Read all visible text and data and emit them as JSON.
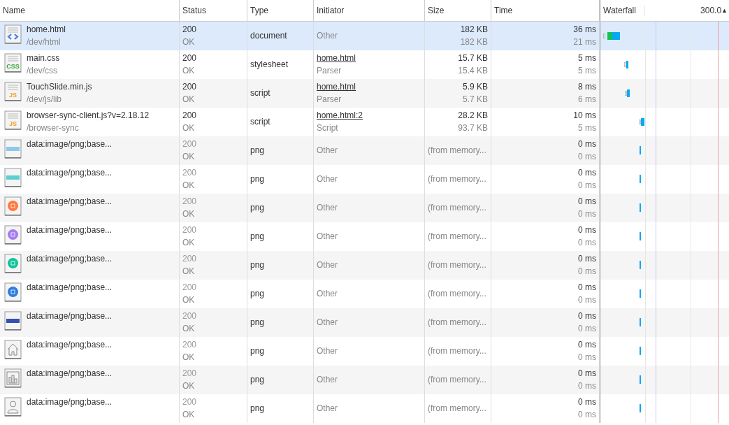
{
  "columns": [
    {
      "label": "Name"
    },
    {
      "label": "Status"
    },
    {
      "label": "Type"
    },
    {
      "label": "Initiator"
    },
    {
      "label": "Size"
    },
    {
      "label": "Time"
    },
    {
      "label": "Waterfall"
    }
  ],
  "waterfall_scale": "300.0",
  "sort_indicator": "▲",
  "rows": [
    {
      "icon": {
        "kind": "html"
      },
      "name": "home.html",
      "path": "/dev/html",
      "status": "200",
      "status_text": "OK",
      "type": "document",
      "initiator": "Other",
      "initiator_link": false,
      "size": "182 KB",
      "size_detail": "182 KB",
      "time": "36 ms",
      "latency": "21 ms",
      "selected": true,
      "from_cache": false
    },
    {
      "icon": {
        "kind": "doc",
        "label": "CSS",
        "color": "#3aa53a"
      },
      "name": "main.css",
      "path": "/dev/css",
      "status": "200",
      "status_text": "OK",
      "type": "stylesheet",
      "initiator": "home.html",
      "initiator_detail": "Parser",
      "initiator_link": true,
      "size": "15.7 KB",
      "size_detail": "15.4 KB",
      "time": "5 ms",
      "latency": "5 ms",
      "selected": false,
      "from_cache": false
    },
    {
      "icon": {
        "kind": "doc",
        "label": "JS",
        "color": "#f0a020"
      },
      "name": "TouchSlide.min.js",
      "path": "/dev/js/lib",
      "status": "200",
      "status_text": "OK",
      "type": "script",
      "initiator": "home.html",
      "initiator_detail": "Parser",
      "initiator_link": true,
      "size": "5.9 KB",
      "size_detail": "5.7 KB",
      "time": "8 ms",
      "latency": "6 ms",
      "selected": false,
      "from_cache": false
    },
    {
      "icon": {
        "kind": "doc",
        "label": "JS",
        "color": "#f0a020"
      },
      "name": "browser-sync-client.js?v=2.18.12",
      "path": "/browser-sync",
      "status": "200",
      "status_text": "OK",
      "type": "script",
      "initiator": "home.html:2",
      "initiator_detail": "Script",
      "initiator_link": true,
      "size": "28.2 KB",
      "size_detail": "93.7 KB",
      "time": "10 ms",
      "latency": "5 ms",
      "selected": false,
      "from_cache": false
    },
    {
      "icon": {
        "kind": "banner",
        "color": "#8fc8e8"
      },
      "name": "data:image/png;base...",
      "status": "200",
      "status_text": "OK",
      "type": "png",
      "initiator": "Other",
      "initiator_link": false,
      "size": "(from memory...",
      "time": "0 ms",
      "latency": "0 ms",
      "selected": false,
      "from_cache": true
    },
    {
      "icon": {
        "kind": "banner",
        "color": "#5ccfd0"
      },
      "name": "data:image/png;base...",
      "status": "200",
      "status_text": "OK",
      "type": "png",
      "initiator": "Other",
      "initiator_link": false,
      "size": "(from memory...",
      "time": "0 ms",
      "latency": "0 ms",
      "selected": false,
      "from_cache": true
    },
    {
      "icon": {
        "kind": "circle",
        "color": "#ff7a3d"
      },
      "name": "data:image/png;base...",
      "status": "200",
      "status_text": "OK",
      "type": "png",
      "initiator": "Other",
      "initiator_link": false,
      "size": "(from memory...",
      "time": "0 ms",
      "latency": "0 ms",
      "selected": false,
      "from_cache": true
    },
    {
      "icon": {
        "kind": "circle",
        "color": "#a67cf0"
      },
      "name": "data:image/png;base...",
      "status": "200",
      "status_text": "OK",
      "type": "png",
      "initiator": "Other",
      "initiator_link": false,
      "size": "(from memory...",
      "time": "0 ms",
      "latency": "0 ms",
      "selected": false,
      "from_cache": true
    },
    {
      "icon": {
        "kind": "circle",
        "color": "#14c29a"
      },
      "name": "data:image/png;base...",
      "status": "200",
      "status_text": "OK",
      "type": "png",
      "initiator": "Other",
      "initiator_link": false,
      "size": "(from memory...",
      "time": "0 ms",
      "latency": "0 ms",
      "selected": false,
      "from_cache": true
    },
    {
      "icon": {
        "kind": "circle",
        "color": "#2f7de0"
      },
      "name": "data:image/png;base...",
      "status": "200",
      "status_text": "OK",
      "type": "png",
      "initiator": "Other",
      "initiator_link": false,
      "size": "(from memory...",
      "time": "0 ms",
      "latency": "0 ms",
      "selected": false,
      "from_cache": true
    },
    {
      "icon": {
        "kind": "banner",
        "color": "#3450b0"
      },
      "name": "data:image/png;base...",
      "status": "200",
      "status_text": "OK",
      "type": "png",
      "initiator": "Other",
      "initiator_link": false,
      "size": "(from memory...",
      "time": "0 ms",
      "latency": "0 ms",
      "selected": false,
      "from_cache": true
    },
    {
      "icon": {
        "kind": "house"
      },
      "name": "data:image/png;base...",
      "status": "200",
      "status_text": "OK",
      "type": "png",
      "initiator": "Other",
      "initiator_link": false,
      "size": "(from memory...",
      "time": "0 ms",
      "latency": "0 ms",
      "selected": false,
      "from_cache": true
    },
    {
      "icon": {
        "kind": "bars"
      },
      "name": "data:image/png;base...",
      "status": "200",
      "status_text": "OK",
      "type": "png",
      "initiator": "Other",
      "initiator_link": false,
      "size": "(from memory...",
      "time": "0 ms",
      "latency": "0 ms",
      "selected": false,
      "from_cache": true
    },
    {
      "icon": {
        "kind": "person"
      },
      "name": "data:image/png;base...",
      "status": "200",
      "status_text": "OK",
      "type": "png",
      "initiator": "Other",
      "initiator_link": false,
      "size": "(from memory...",
      "time": "0 ms",
      "latency": "0 ms",
      "selected": false,
      "from_cache": true
    }
  ]
}
